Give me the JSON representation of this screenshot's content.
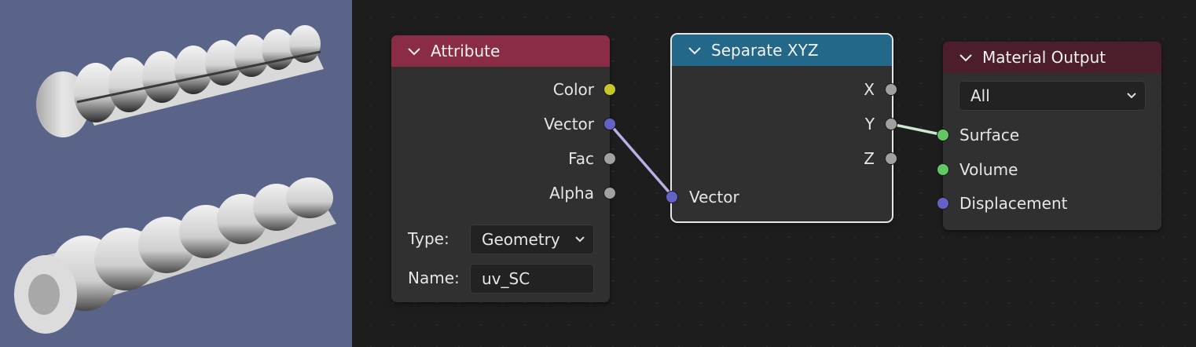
{
  "viewport": {
    "background": "#5a6489"
  },
  "nodes": {
    "attribute": {
      "title": "Attribute",
      "header_color": "#8a2c45",
      "outputs": [
        "Color",
        "Vector",
        "Fac",
        "Alpha"
      ],
      "type_label": "Type:",
      "type_value": "Geometry",
      "name_label": "Name:",
      "name_value": "uv_SC"
    },
    "separate": {
      "title": "Separate XYZ",
      "header_color": "#236789",
      "outputs": [
        "X",
        "Y",
        "Z"
      ],
      "input": "Vector"
    },
    "output": {
      "title": "Material Output",
      "header_color": "#4c1d2a",
      "target": "All",
      "inputs": [
        "Surface",
        "Volume",
        "Displacement"
      ]
    }
  },
  "socket_colors": {
    "color": "#c7c729",
    "vector": "#6363c7",
    "float": "#a1a1a1",
    "shader": "#63c763"
  },
  "icons": {
    "collapse": "chevron-down-icon",
    "dropdown": "chevron-down-icon"
  }
}
